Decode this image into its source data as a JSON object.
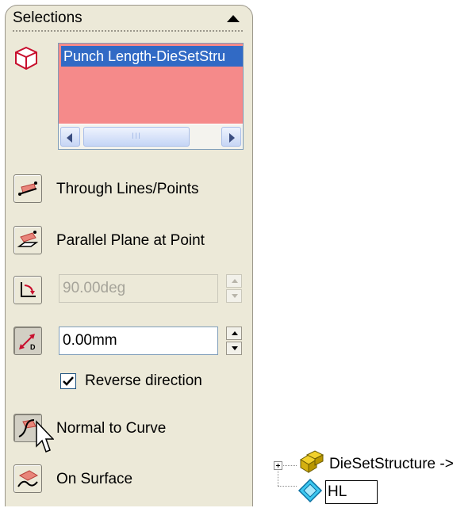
{
  "panel": {
    "title": "Selections",
    "selection_list": {
      "items": [
        "Punch Length-DieSetStru"
      ],
      "scrollbar_thumb_grip": "III"
    },
    "options": [
      {
        "label": "Through Lines/Points",
        "icon": "through-lines-points-icon"
      },
      {
        "label": "Parallel Plane at Point",
        "icon": "parallel-plane-at-point-icon"
      }
    ],
    "angle_field": {
      "value": "90.00deg",
      "enabled": false,
      "icon": "angle-icon"
    },
    "distance_field": {
      "value": "0.00mm",
      "enabled": true,
      "icon": "offset-distance-icon"
    },
    "reverse_direction": {
      "label": "Reverse direction",
      "checked": true
    },
    "normal_to_curve": {
      "label": "Normal to Curve",
      "icon": "normal-to-curve-icon"
    },
    "on_surface": {
      "label": "On Surface",
      "icon": "on-surface-icon"
    }
  },
  "feature_tree": {
    "parent_label": "DieSetStructure ->",
    "child_edit_value": "HL"
  },
  "colors": {
    "panel_bg": "#ece9d8",
    "selection_list_bg": "#f58a8a",
    "selected_item_bg": "#316ac5"
  }
}
